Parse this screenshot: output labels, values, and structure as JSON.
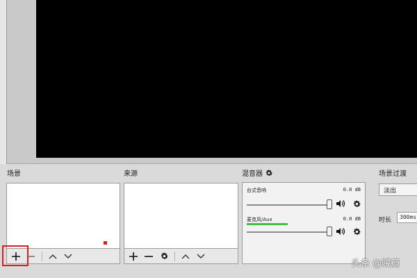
{
  "docks": {
    "scenes": {
      "title": "场景"
    },
    "sources": {
      "title": "来源"
    },
    "mixer": {
      "title": "混音器"
    },
    "transitions": {
      "title": "场景过渡"
    }
  },
  "mixer": {
    "channels": [
      {
        "name": "台式音响",
        "db": "0.0 dB",
        "meter_level": 0.0,
        "volume": 1.0
      },
      {
        "name": "麦克风/Aux",
        "db": "0.0 dB",
        "meter_level": 0.5,
        "volume": 1.0
      }
    ]
  },
  "transitions": {
    "selected": "淡出",
    "duration_label": "时长",
    "duration_value": "300ms"
  },
  "watermark": "头条 @贼瘾"
}
